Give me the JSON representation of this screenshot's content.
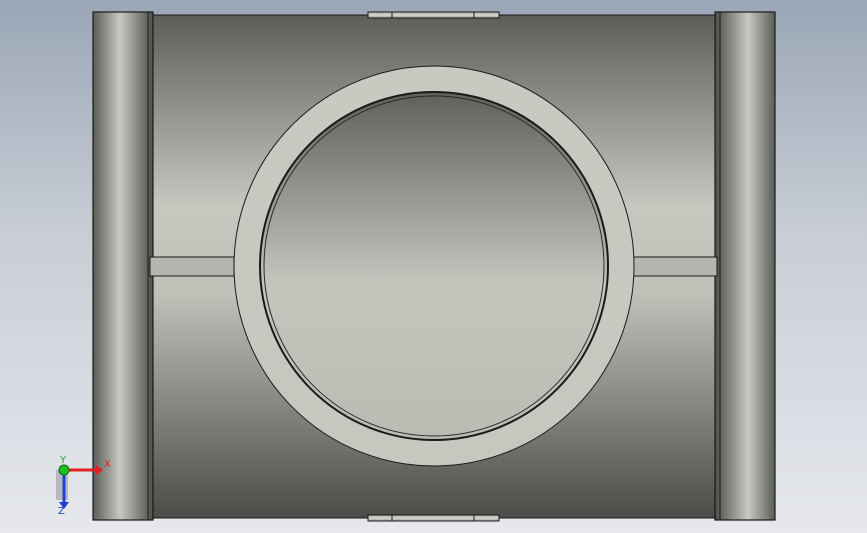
{
  "viewport": {
    "model": "pipe-tee",
    "background_top": "#9aa6b6",
    "background_bottom": "#e6e8ec"
  },
  "triad": {
    "x_label": "X",
    "y_label": "Y",
    "z_label": "Z",
    "x_color": "#e02020",
    "y_color": "#20c020",
    "z_color": "#2040d0"
  }
}
